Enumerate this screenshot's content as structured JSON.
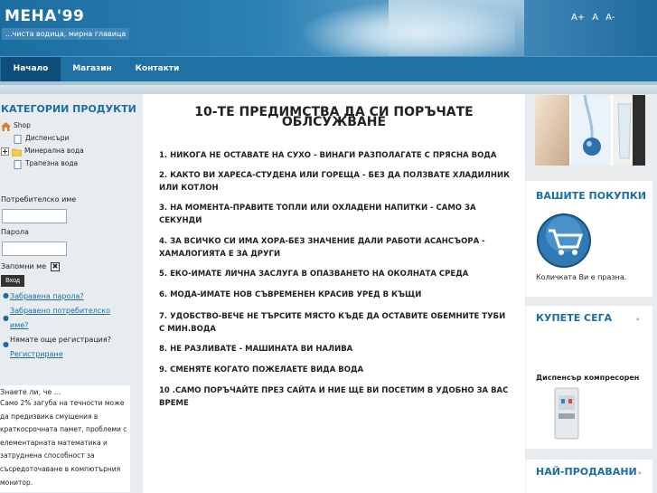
{
  "header": {
    "logo": "МЕНА'99",
    "slogan": "...чиста водица, мирна главица",
    "font_sizes": [
      "A+",
      "A",
      "A-"
    ]
  },
  "nav": {
    "items": [
      "Начало",
      "Магазин",
      "Контакти"
    ],
    "active": "Начало"
  },
  "sidebar": {
    "categories_title": "КАТЕГОРИИ ПРОДУКТИ",
    "tree": [
      "Shop",
      "Диспенсъри",
      "Минерална вода",
      "Трапезна вода"
    ],
    "username_label": "Потребителско име",
    "username_value": "",
    "password_label": "Парола",
    "password_value": "",
    "remember_label": "Запомни ме",
    "remember_checked": "✖",
    "login_button": "Вход",
    "forgot_password": "Забравена парола?",
    "forgot_username_1": "Забравено потребителско",
    "forgot_username_2": "име?",
    "no_account": "Нямате още регистрация?",
    "register": "Регистриране",
    "did_you_know_title": "Знаете ли, че ...",
    "did_you_know_text": "Само 2% загуба на течности може да предизвика смущения в краткосрочната памет, проблеми с елементарната математика и затруднена способност за съсредоточаване в компютърния монитор."
  },
  "main": {
    "title_line1": "10-ТЕ ПРЕДИМСТВА ДА СИ ПОРЪЧАТЕ",
    "title_line2": "ОБЛСУЖВАНЕ",
    "items": [
      "1. НИКОГА НЕ ОСТАВАТЕ НА СУХО - ВИНАГИ РАЗПОЛАГАТЕ С ПРЯСНА ВОДА",
      "2. КАКТО ВИ ХАРЕСА-СТУДЕНА ИЛИ ГОРЕЩА - БЕЗ ДА ПОЛЗВАТЕ ХЛАДИЛНИК ИЛИ КОТЛОН",
      "3. НА МОМЕНТА-ПРАВИТЕ ТОПЛИ ИЛИ ОХЛАДЕНИ НАПИТКИ - САМО ЗА СЕКУНДИ",
      "4. ЗА ВСИЧКО СИ ИМА ХОРА-БЕЗ ЗНАЧЕНИЕ ДАЛИ РАБОТИ АСАНСЪОРА - ХАМАЛОГИЯТА Е ЗА ДРУГИ",
      "5. ЕКО-ИМАТЕ ЛИЧНА ЗАСЛУГА В ОПАЗВАНЕТО НА ОКОЛНАТА СРЕДА",
      "6. МОДА-ИМАТЕ НОВ СЪВРЕМЕНЕН КРАСИВ УРЕД В КЪЩИ",
      "7. УДОБСТВО-ВЕЧЕ НЕ ТЪРСИТЕ МЯСТО КЪДЕ ДА ОСТАВИТЕ ОБЕМНИТЕ ТУБИ С МИН.ВОДА",
      "8. НЕ РАЗЛИВАТЕ - МАШИНАТА ВИ НАЛИВА",
      "9. СМЕНЯТЕ КОГАТО ПОЖЕЛАЕТЕ ВИДА ВОДА",
      "10 .САМО ПОРЪЧАЙТЕ ПРЕЗ САЙТА И НИЕ ЩЕ ВИ ПОСЕТИМ В УДОБНО ЗА ВАС ВРЕМЕ"
    ]
  },
  "right": {
    "cart_title": "ВАШИТЕ ПОКУПКИ",
    "cart_empty": "Количката Ви е празна.",
    "buy_now_title": "КУПЕТЕ СЕГА",
    "buy_now_product": "Диспенсър компресорен",
    "bestsellers_title": "НАЙ-ПРОДАВАНИ"
  },
  "colors": {
    "accent": "#1b6ea3",
    "nav": "#1f70a3",
    "nav_active": "#0e4e78"
  }
}
